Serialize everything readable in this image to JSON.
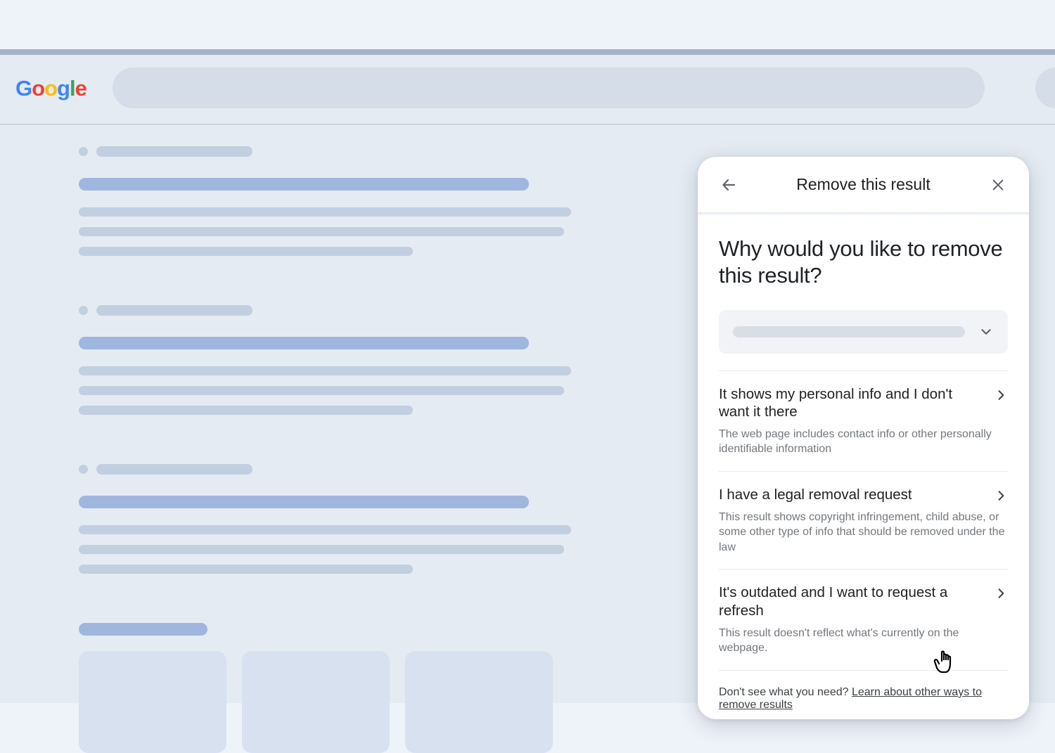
{
  "logo": {
    "letters": [
      "G",
      "o",
      "o",
      "g",
      "l",
      "e"
    ]
  },
  "panel": {
    "title": "Remove this result",
    "question": "Why would you like to remove this result?",
    "options": [
      {
        "title": "It shows my personal info and I don't want it there",
        "desc": "The web page includes contact info or other personally identifiable information"
      },
      {
        "title": "I have a legal removal request",
        "desc": "This result shows copyright infringement, child abuse, or some other type of info that should be removed under the law"
      },
      {
        "title": "It's outdated and I want to request a refresh",
        "desc": "This result doesn't reflect what's currently on the webpage."
      }
    ],
    "footer": {
      "prompt": "Don't see what you need? ",
      "link": "Learn about other ways to remove results"
    }
  }
}
